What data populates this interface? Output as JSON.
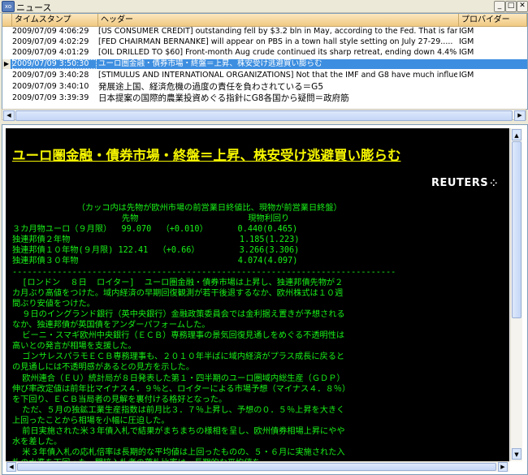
{
  "window": {
    "app_icon": "xo",
    "title": "ニュース",
    "min": "_",
    "max": "□",
    "close": "✕"
  },
  "grid": {
    "columns": [
      "タイムスタンプ",
      "ヘッダー",
      "プロバイダー"
    ],
    "rows": [
      {
        "ts": "2009/07/09 4:06:29",
        "headline": "[US CONSUMER CREDIT] outstanding fell by $3.2 bln in May, according        to the Fed.  That is far less t...",
        "provider": "IGM"
      },
      {
        "ts": "2009/07/09 4:02:29",
        "headline": "[FED CHAIRMAN BERNANKE] will appear on PBS in a town hall style        setting on July 27-29.....",
        "provider": "IGM"
      },
      {
        "ts": "2009/07/09 4:01:29",
        "headline": "[OIL DRILLED TO $60] Front-month Aug crude continued its sharp        retreat, ending down 4.4% at...",
        "provider": "IGM"
      },
      {
        "ts": "2009/07/09 3:50:30",
        "headline": "ユーロ圏金融・債券市場・終盤＝上昇、株安受け逃避買い膨らむ",
        "provider": ""
      },
      {
        "ts": "2009/07/09 3:40:28",
        "headline": "[STIMULUS AND INTERNATIONAL ORGANIZATIONS] Not that the IMF and G8        have much influence ...",
        "provider": "IGM"
      },
      {
        "ts": "2009/07/09 3:40:10",
        "headline": "発展途上国、経済危機の過度の責任を負わされている＝G5",
        "provider": ""
      },
      {
        "ts": "2009/07/09 3:39:39",
        "headline": "日本提案の国際的農業投資めぐる指針にG8各国から疑問＝政府筋",
        "provider": ""
      }
    ],
    "selected_row_marker": "▶"
  },
  "article": {
    "headline": "ユーロ圏金融・債券市場・終盤＝上昇、株安受け逃避買い膨らむ",
    "logo_text": "REUTERS",
    "logo_dots": "⁘",
    "lines": [
      "             （カッコ内は先物が欧州市場の前営業日終値比、現物が前営業日終盤）",
      "                      先物                      現物利回り",
      "３カ月物ユーロ（９月限）  99.070  （+0.010）      0.440(0.465)",
      "独連邦債２年物                                  1.185(1.223)",
      "独連邦債１０年物(９月限) 122.41  （+0.66）        3.266(3.306)",
      "独連邦債３０年物                                4.074(4.097)",
      "-----------------------------------------------------------------------------",
      "  [ロンドン  ８日  ロイター]  ユーロ圏金融・債券市場は上昇し、独連邦債先物が２",
      "カ月ぶり高値をつけた。域内経済の早期回復観測が若干後退するなか、欧州株式は１０週",
      "間ぶり安値をつけた。",
      "  ９日のイングランド銀行（英中央銀行）金融政策委員会では金利据え置きが予想される",
      "なか、独連邦債が英国債をアンダーパフォームした。",
      "  ビーニ・スマギ欧州中央銀行（ＥＣＢ）専務理事の景気回復見通しをめぐる不透明性は",
      "高いとの発言が相場を支援した。",
      "  ゴンサレスパラモＥＣＢ専務理事も、２０１０年半ばに域内経済がプラス成長に戻ると",
      "の見通しには不透明感があるとの見方を示した。",
      "  欧州連合（ＥＵ）統計局が８日発表した第１・四半期のユーロ圏域内総生産（ＧＤＰ）",
      "伸び率改定値は前年比マイナス４．９％と、ロイターによる市場予想（マイナス４．８％）",
      "を下回り、ＥＣＢ当局者の見解を裏付ける格好となった。",
      "  ただ、５月の独鉱工業生産指数は前月比３．７％上昇し、予想の０．５％上昇を大きく",
      "上回ったことから相場を小幅に圧迫した。",
      "  前日実施された米３年債入札で結果がまちまちの様相を呈し、欧州債券相場上昇にやや",
      "水を差した。",
      "  米３年債入札の応札倍率は長期的な平均値は上回ったものの、５・６月に実施された入",
      "札の水準を下回った。間接入札者の落札比率は、長期的な平均値を"
    ]
  }
}
